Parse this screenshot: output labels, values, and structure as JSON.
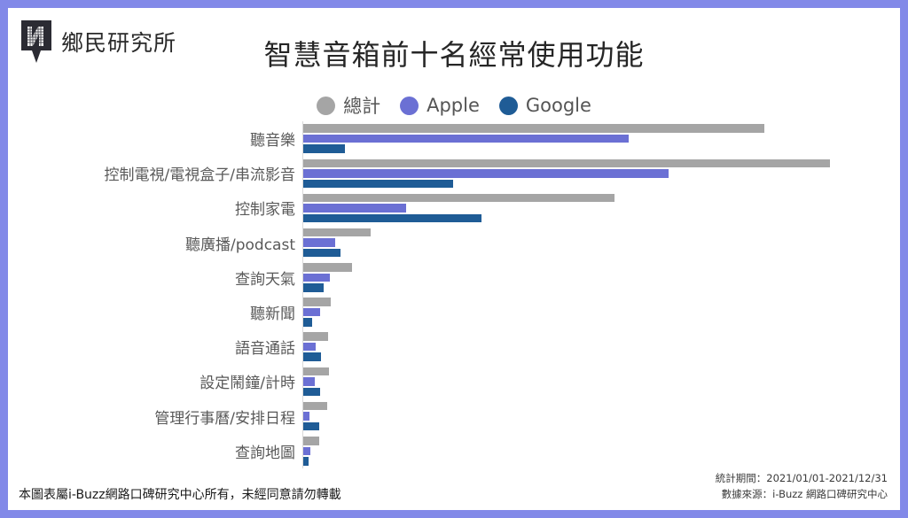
{
  "brand": {
    "logo_icon": "location-pin-n-icon",
    "logo_text": "鄉民研究所"
  },
  "footer": {
    "left_notice": "本圖表屬i-Buzz網路口碑研究中心所有，未經同意請勿轉載",
    "period": "統計期間：2021/01/01-2021/12/31",
    "source": "數據來源：i-Buzz 網路口碑研究中心"
  },
  "colors": {
    "border": "#8289e8",
    "background": "#ffffff",
    "total": "#a5a5a5",
    "apple": "#6b70d4",
    "google": "#1f5c96",
    "axis": "#d9d9d9",
    "title_text": "#262626",
    "label_text": "#595959"
  },
  "chart_data": {
    "type": "bar",
    "orientation": "horizontal",
    "title": "智慧音箱前十名經常使用功能",
    "subtitle": "",
    "xlabel": "",
    "ylabel": "",
    "grid": false,
    "legend_position": "top-center",
    "xlim": [
      0,
      70
    ],
    "categories": [
      "聽音樂",
      "控制電視/電視盒子/串流影音",
      "控制家電",
      "聽廣播/podcast",
      "查詢天氣",
      "聽新聞",
      "語音通話",
      "設定鬧鐘/計時",
      "管理行事曆/安排日程",
      "查詢地圖"
    ],
    "series": [
      {
        "name": "總計",
        "color": "#a5a5a5",
        "values": [
          56.0,
          64.0,
          37.8,
          8.2,
          5.9,
          3.3,
          3.0,
          3.1,
          2.9,
          1.9
        ]
      },
      {
        "name": "Apple",
        "color": "#6b70d4",
        "values": [
          39.5,
          44.4,
          12.5,
          3.9,
          3.2,
          2.0,
          1.5,
          1.4,
          0.7,
          0.9
        ]
      },
      {
        "name": "Google",
        "color": "#1f5c96",
        "values": [
          5.1,
          18.2,
          21.6,
          4.5,
          2.5,
          1.1,
          2.2,
          2.0,
          1.9,
          0.6
        ]
      }
    ]
  }
}
